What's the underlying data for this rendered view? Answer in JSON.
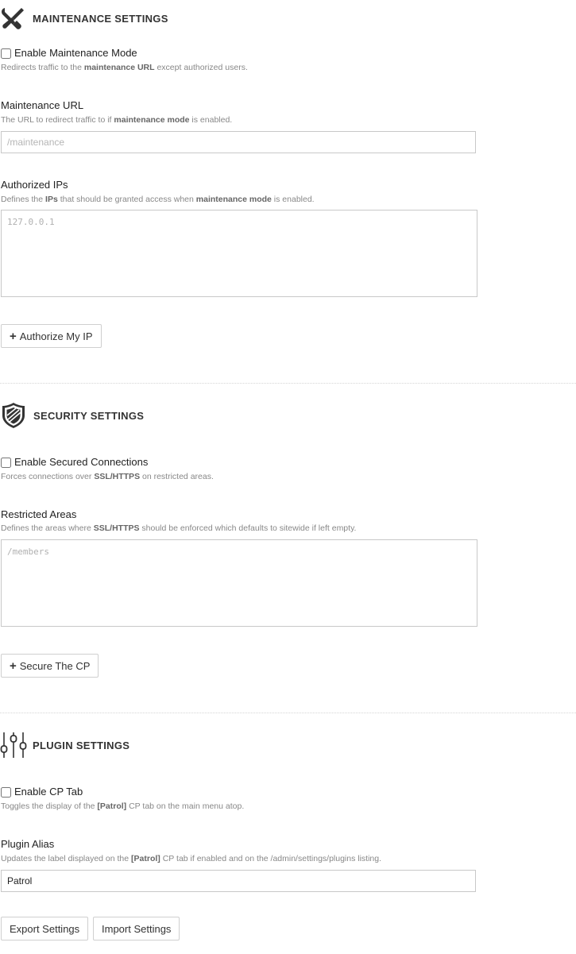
{
  "maintenance": {
    "title": "MAINTENANCE SETTINGS",
    "icon": "tools-icon",
    "enable_label": "Enable Maintenance Mode",
    "enable_checked": false,
    "enable_hint": {
      "a": "Redirects traffic to the ",
      "b": "maintenance URL",
      "c": " except authorized users."
    },
    "url_label": "Maintenance URL",
    "url_hint": {
      "a": "The URL to redirect traffic to if ",
      "b": "maintenance mode",
      "c": " is enabled."
    },
    "url_value": "",
    "url_placeholder": "/maintenance",
    "ips_label": "Authorized IPs",
    "ips_hint": {
      "a": "Defines the ",
      "b": "IPs",
      "c": " that should be granted access when ",
      "d": "maintenance mode",
      "e": " is enabled."
    },
    "ips_value": "",
    "ips_placeholder": "127.0.0.1",
    "button_label": "Authorize My IP"
  },
  "security": {
    "title": "SECURITY SETTINGS",
    "icon": "shield-icon",
    "enable_label": "Enable Secured Connections",
    "enable_checked": false,
    "enable_hint": {
      "a": "Forces connections over ",
      "b": "SSL/HTTPS",
      "c": " on restricted areas."
    },
    "areas_label": "Restricted Areas",
    "areas_hint": {
      "a": "Defines the areas where ",
      "b": "SSL/HTTPS",
      "c": " should be enforced which defaults to sitewide if left empty."
    },
    "areas_value": "",
    "areas_placeholder": "/members",
    "button_label": "Secure The CP"
  },
  "plugin": {
    "title": "PLUGIN SETTINGS",
    "icon": "sliders-icon",
    "enable_label": "Enable CP Tab",
    "enable_checked": false,
    "enable_hint": {
      "a": "Toggles the display of the ",
      "b": "[Patrol]",
      "c": " CP tab on the main menu atop."
    },
    "alias_label": "Plugin Alias",
    "alias_hint": {
      "a": "Updates the label displayed on the ",
      "b": "[Patrol]",
      "c": " CP tab if enabled and on the /admin/settings/plugins listing."
    },
    "alias_value": "Patrol",
    "export_label": "Export Settings",
    "import_label": "Import Settings"
  }
}
